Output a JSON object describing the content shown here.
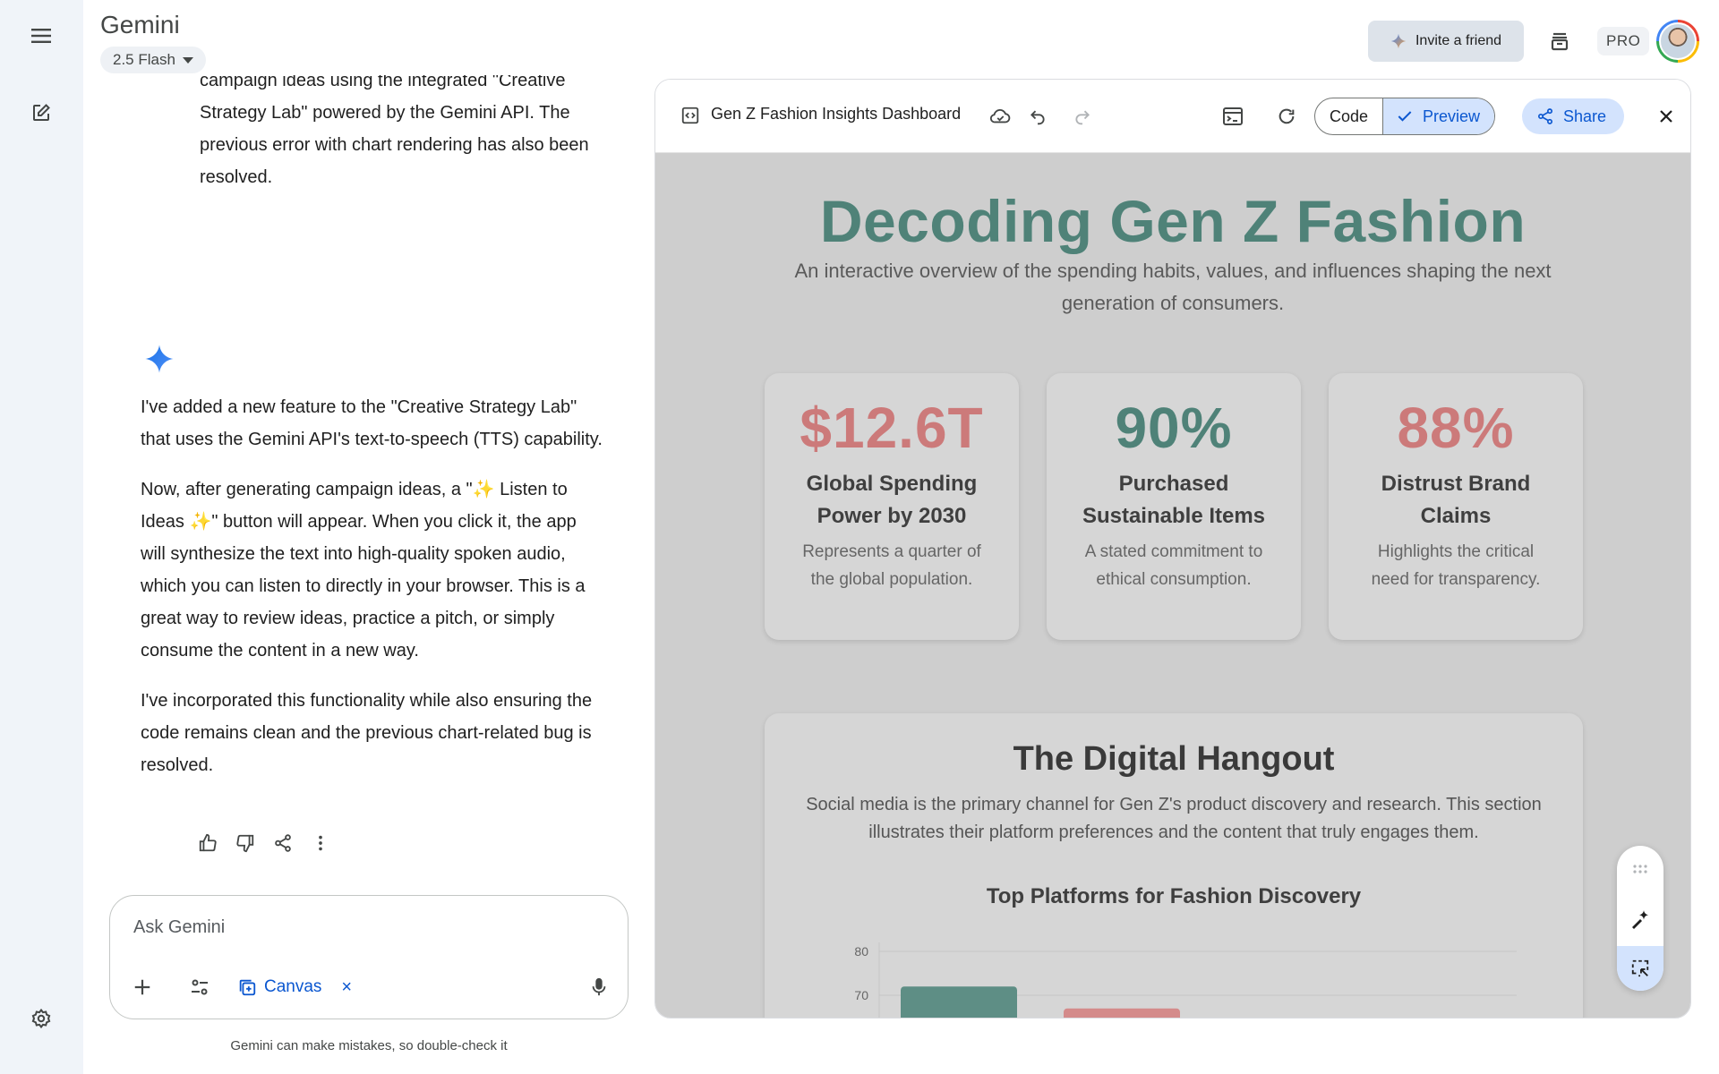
{
  "header": {
    "app_title": "Gemini",
    "model": "2.5 Flash",
    "invite": "Invite a friend",
    "pro": "PRO"
  },
  "chat": {
    "previous_message": "campaign ideas using the integrated \"Creative Strategy Lab\" powered by the Gemini API. The previous error with chart rendering has also been resolved.",
    "response": [
      "I've added a new feature to the \"Creative Strategy Lab\" that uses the Gemini API's text-to-speech (TTS) capability.",
      "Now, after generating campaign ideas, a \"✨ Listen to Ideas ✨\" button will appear. When you click it, the app will synthesize the text into high-quality spoken audio, which you can listen to directly in your browser. This is a great way to review ideas, practice a pitch, or simply consume the content in a new way.",
      "I've incorporated this functionality while also ensuring the code remains clean and the previous chart-related bug is resolved."
    ]
  },
  "input": {
    "placeholder": "Ask Gemini",
    "canvas_chip": "Canvas",
    "canvas_close": "×",
    "disclaimer": "Gemini can make mistakes, so double-check it"
  },
  "panel": {
    "doc_title": "Gen Z Fashion Insights Dashboard",
    "code_label": "Code",
    "preview_label": "Preview",
    "share_label": "Share"
  },
  "dashboard": {
    "title": "Decoding Gen Z Fashion",
    "subtitle": "An interactive overview of the spending habits, values, and influences shaping the next generation of consumers.",
    "stats": [
      {
        "value": "$12.6T",
        "label": "Global Spending Power by 2030",
        "desc": "Represents a quarter of the global population.",
        "color": "#cc7a7a"
      },
      {
        "value": "90%",
        "label": "Purchased Sustainable Items",
        "desc": "A stated commitment to ethical consumption.",
        "color": "#4f8278"
      },
      {
        "value": "88%",
        "label": "Distrust Brand Claims",
        "desc": "Highlights the critical need for transparency.",
        "color": "#cc7a7a"
      }
    ],
    "section_title": "The Digital Hangout",
    "section_desc": "Social media is the primary channel for Gen Z's product discovery and research. This section illustrates their platform preferences and the content that truly engages them.",
    "chart_title": "Top Platforms for Fashion Discovery"
  },
  "chart_data": {
    "type": "bar",
    "title": "Top Platforms for Fashion Discovery",
    "visible_ticks": [
      80,
      70
    ],
    "ylim": [
      0,
      80
    ],
    "values": [
      72,
      67
    ],
    "colors": [
      "#5e8e85",
      "#d48b8b"
    ],
    "grid": true
  },
  "colors": {
    "accent_blue": "#0b57d0",
    "teal": "#4f8278",
    "rose": "#cc7a7a",
    "preview_bg": "#cecece"
  }
}
